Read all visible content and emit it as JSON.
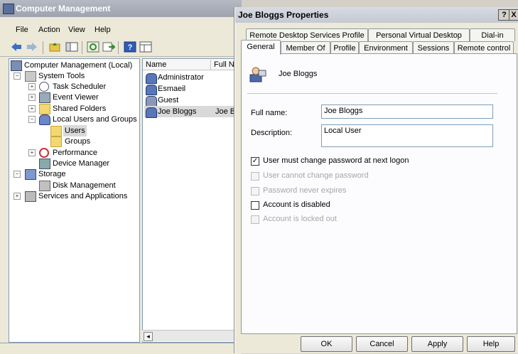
{
  "window": {
    "title": "Computer Management"
  },
  "menu": [
    "File",
    "Action",
    "View",
    "Help"
  ],
  "tree": {
    "root": "Computer Management (Local)",
    "system_tools": "System Tools",
    "task_scheduler": "Task Scheduler",
    "event_viewer": "Event Viewer",
    "shared_folders": "Shared Folders",
    "local_users_groups": "Local Users and Groups",
    "users": "Users",
    "groups": "Groups",
    "performance": "Performance",
    "device_manager": "Device Manager",
    "storage": "Storage",
    "disk_management": "Disk Management",
    "services_apps": "Services and Applications"
  },
  "list": {
    "columns": [
      "Name",
      "Full Na"
    ],
    "rows": [
      {
        "name": "Administrator",
        "full": ""
      },
      {
        "name": "Esmaeil",
        "full": ""
      },
      {
        "name": "Guest",
        "full": ""
      },
      {
        "name": "Joe Bloggs",
        "full": "Joe Bl"
      }
    ]
  },
  "dialog": {
    "title": "Joe Bloggs Properties",
    "help_btn": "?",
    "close_btn": "X",
    "tabs_row1": [
      "Remote Desktop Services Profile",
      "Personal Virtual Desktop",
      "Dial-in"
    ],
    "tabs_row2": [
      "General",
      "Member Of",
      "Profile",
      "Environment",
      "Sessions",
      "Remote control"
    ],
    "user_name": "Joe Bloggs",
    "full_name_label": "Full name:",
    "full_name_value": "Joe Bloggs",
    "description_label": "Description:",
    "description_value": "Local User",
    "options": [
      {
        "label": "User must change password at next logon",
        "checked": true,
        "enabled": true
      },
      {
        "label": "User cannot change password",
        "checked": false,
        "enabled": false
      },
      {
        "label": "Password never expires",
        "checked": false,
        "enabled": false
      },
      {
        "label": "Account is disabled",
        "checked": false,
        "enabled": true
      },
      {
        "label": "Account is locked out",
        "checked": false,
        "enabled": false
      }
    ],
    "buttons": {
      "ok": "OK",
      "cancel": "Cancel",
      "apply": "Apply",
      "help": "Help"
    }
  }
}
